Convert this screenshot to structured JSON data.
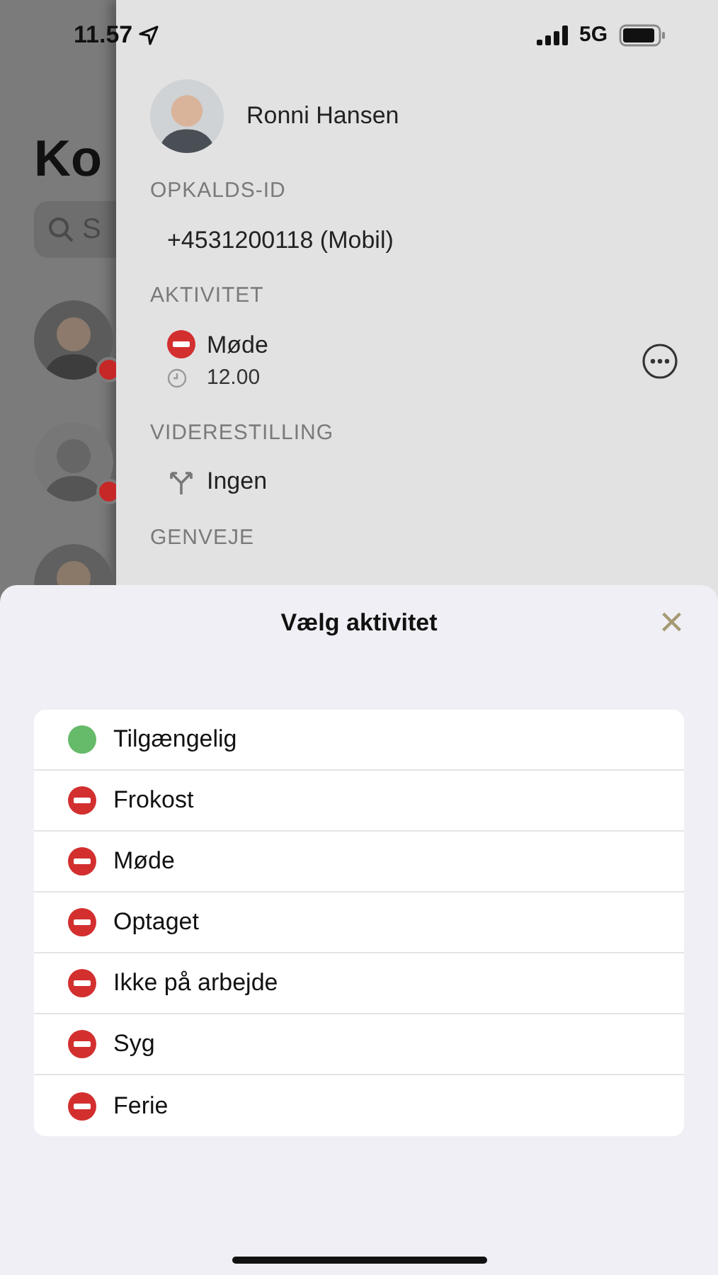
{
  "status_bar": {
    "time": "11.57",
    "network": "5G"
  },
  "background_list": {
    "title": "Ko",
    "search_placeholder": "S"
  },
  "contact_panel": {
    "name": "Ronni Hansen",
    "sections": [
      {
        "heading": "OPKALDS-ID",
        "kind": "text",
        "value": "+4531200118 (Mobil)"
      },
      {
        "heading": "AKTIVITET",
        "kind": "activity",
        "value": "Møde",
        "time": "12.00"
      },
      {
        "heading": "VIDERESTILLING",
        "kind": "forward",
        "value": "Ingen"
      },
      {
        "heading": "GENVEJE",
        "kind": "heading_only"
      }
    ]
  },
  "sheet": {
    "title": "Vælg aktivitet",
    "close": "×",
    "activities": [
      {
        "label": "Tilgængelig",
        "kind": "available"
      },
      {
        "label": "Frokost",
        "kind": "busy"
      },
      {
        "label": "Møde",
        "kind": "busy"
      },
      {
        "label": "Optaget",
        "kind": "busy"
      },
      {
        "label": "Ikke på arbejde",
        "kind": "busy"
      },
      {
        "label": "Syg",
        "kind": "busy"
      },
      {
        "label": "Ferie",
        "kind": "busy"
      }
    ]
  }
}
